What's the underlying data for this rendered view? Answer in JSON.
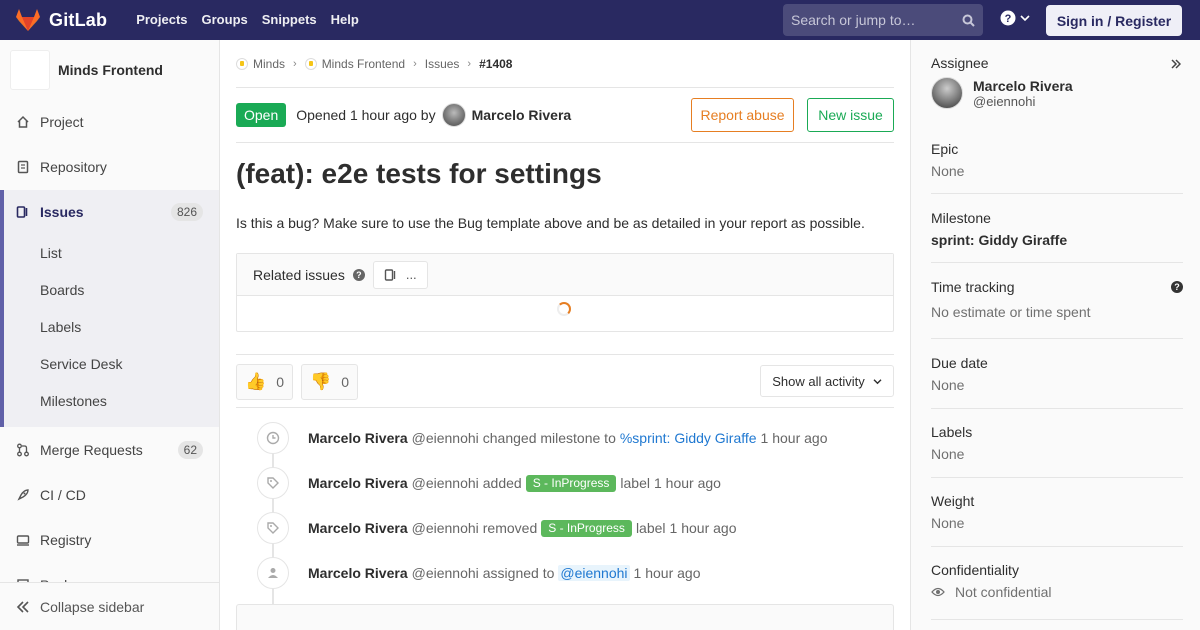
{
  "navbar": {
    "brand": "GitLab",
    "links": [
      "Projects",
      "Groups",
      "Snippets",
      "Help"
    ],
    "search_placeholder": "Search or jump to…",
    "signin_label": "Sign in / Register"
  },
  "sidebar": {
    "project_name": "Minds Frontend",
    "items": [
      {
        "label": "Project",
        "icon": "home-icon"
      },
      {
        "label": "Repository",
        "icon": "doc-icon"
      },
      {
        "label": "Issues",
        "icon": "issues-icon",
        "count": "826"
      },
      {
        "label": "Merge Requests",
        "icon": "merge-icon",
        "count": "62"
      },
      {
        "label": "CI / CD",
        "icon": "rocket-icon"
      },
      {
        "label": "Registry",
        "icon": "container-icon"
      },
      {
        "label": "Packages",
        "icon": "package-icon"
      }
    ],
    "sub_items": [
      "List",
      "Boards",
      "Labels",
      "Service Desk",
      "Milestones"
    ],
    "collapse_label": "Collapse sidebar"
  },
  "breadcrumb": [
    "Minds",
    "Minds Frontend",
    "Issues",
    "#1408"
  ],
  "issue": {
    "status": "Open",
    "opened_text": "Opened 1 hour ago by",
    "author": "Marcelo Rivera",
    "report_abuse": "Report abuse",
    "new_issue": "New issue",
    "title": "(feat): e2e tests for settings",
    "description": "Is this a bug? Make sure to use the Bug template above and be as detailed in your report as possible."
  },
  "related": {
    "title": "Related issues",
    "count": "..."
  },
  "awards": {
    "thumbs_up": "0",
    "thumbs_down": "0",
    "activity_filter": "Show all activity"
  },
  "timeline": [
    {
      "author": "Marcelo Rivera",
      "username": "@eiennohi",
      "action": "changed milestone to",
      "link": "%sprint: Giddy Giraffe",
      "time": "1 hour ago",
      "icon": "clock-icon"
    },
    {
      "author": "Marcelo Rivera",
      "username": "@eiennohi",
      "action": "added",
      "label": "S - InProgress",
      "suffix": "label",
      "time": "1 hour ago",
      "icon": "tag-icon"
    },
    {
      "author": "Marcelo Rivera",
      "username": "@eiennohi",
      "action": "removed",
      "label": "S - InProgress",
      "suffix": "label",
      "time": "1 hour ago",
      "icon": "tag-icon"
    },
    {
      "author": "Marcelo Rivera",
      "username": "@eiennohi",
      "action": "assigned to",
      "mention": "@eiennohi",
      "time": "1 hour ago",
      "icon": "user-icon"
    }
  ],
  "right": {
    "assignee_title": "Assignee",
    "assignee_name": "Marcelo Rivera",
    "assignee_user": "@eiennohi",
    "epic_title": "Epic",
    "epic_value": "None",
    "milestone_title": "Milestone",
    "milestone_value": "sprint: Giddy Giraffe",
    "time_title": "Time tracking",
    "time_value": "No estimate or time spent",
    "due_title": "Due date",
    "due_value": "None",
    "labels_title": "Labels",
    "labels_value": "None",
    "weight_title": "Weight",
    "weight_value": "None",
    "conf_title": "Confidentiality",
    "conf_value": "Not confidential"
  },
  "colors": {
    "navbar": "#292961",
    "open_badge": "#1aaa55",
    "abuse": "#e67e22",
    "link": "#1f78d1",
    "label": "#5cb85c"
  }
}
